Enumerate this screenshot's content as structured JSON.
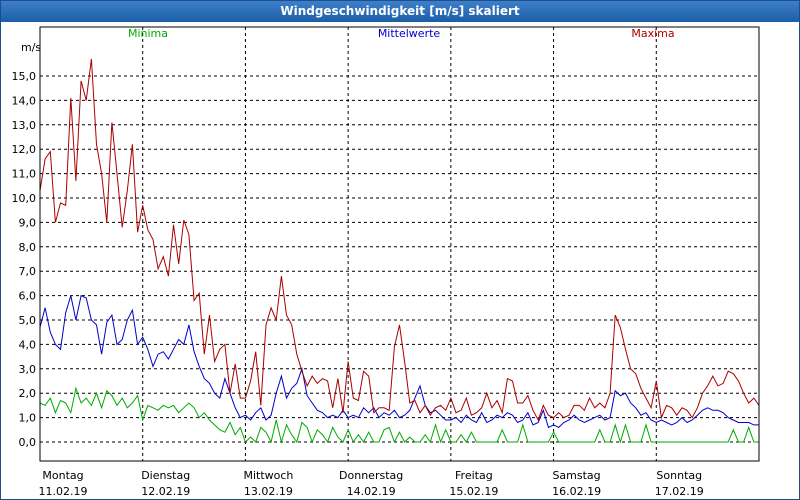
{
  "window": {
    "title": "Windgeschwindigkeit [m/s] skaliert"
  },
  "chart_data": {
    "type": "line",
    "title": "Windgeschwindigkeit [m/s] skaliert",
    "ylabel": "m/s",
    "ylim": [
      0,
      16
    ],
    "yticks": [
      0,
      1,
      2,
      3,
      4,
      5,
      6,
      7,
      8,
      9,
      10,
      11,
      12,
      13,
      14,
      15
    ],
    "ytick_labels": [
      "0,0",
      "1,0",
      "2,0",
      "3,0",
      "4,0",
      "5,0",
      "6,0",
      "7,0",
      "8,0",
      "9,0",
      "10,0",
      "11,0",
      "12,0",
      "13,0",
      "14,0",
      "15,0"
    ],
    "xlim": [
      0,
      7
    ],
    "grid": true,
    "legend": "top",
    "days": [
      {
        "weekday": "Montag",
        "date": "11.02.19"
      },
      {
        "weekday": "Dienstag",
        "date": "12.02.19"
      },
      {
        "weekday": "Mittwoch",
        "date": "13.02.19"
      },
      {
        "weekday": "Donnerstag",
        "date": "14.02.19"
      },
      {
        "weekday": "Freitag",
        "date": "15.02.19"
      },
      {
        "weekday": "Samstag",
        "date": "16.02.19"
      },
      {
        "weekday": "Sonntag",
        "date": "17.02.19"
      }
    ],
    "series": [
      {
        "name": "Minima",
        "color": "#00aa00",
        "x": [
          0,
          0.05,
          0.1,
          0.15,
          0.2,
          0.25,
          0.3,
          0.35,
          0.4,
          0.45,
          0.5,
          0.55,
          0.6,
          0.65,
          0.7,
          0.75,
          0.8,
          0.85,
          0.9,
          0.95,
          1,
          1.05,
          1.1,
          1.15,
          1.2,
          1.25,
          1.3,
          1.35,
          1.4,
          1.45,
          1.5,
          1.55,
          1.6,
          1.65,
          1.7,
          1.75,
          1.8,
          1.85,
          1.9,
          1.95,
          2,
          2.05,
          2.1,
          2.15,
          2.2,
          2.25,
          2.3,
          2.35,
          2.4,
          2.45,
          2.5,
          2.55,
          2.6,
          2.65,
          2.7,
          2.75,
          2.8,
          2.85,
          2.9,
          2.95,
          3,
          3.05,
          3.1,
          3.15,
          3.2,
          3.25,
          3.3,
          3.35,
          3.4,
          3.45,
          3.5,
          3.55,
          3.6,
          3.65,
          3.7,
          3.75,
          3.8,
          3.85,
          3.9,
          3.95,
          4,
          4.05,
          4.1,
          4.15,
          4.2,
          4.25,
          4.3,
          4.35,
          4.4,
          4.45,
          4.5,
          4.55,
          4.6,
          4.65,
          4.7,
          4.75,
          4.8,
          4.85,
          4.9,
          4.95,
          5,
          5.05,
          5.1,
          5.15,
          5.2,
          5.25,
          5.3,
          5.35,
          5.4,
          5.45,
          5.5,
          5.55,
          5.6,
          5.65,
          5.7,
          5.75,
          5.8,
          5.85,
          5.9,
          5.95,
          6,
          6.05,
          6.1,
          6.15,
          6.2,
          6.25,
          6.3,
          6.35,
          6.4,
          6.45,
          6.5,
          6.55,
          6.6,
          6.65,
          6.7,
          6.75,
          6.8,
          6.85,
          6.9,
          6.95,
          7
        ],
        "values": [
          1.6,
          1.5,
          1.8,
          1.2,
          1.7,
          1.6,
          1.2,
          2.2,
          1.6,
          1.8,
          1.5,
          2.0,
          1.4,
          2.1,
          1.9,
          1.5,
          1.8,
          1.4,
          1.6,
          1.9,
          0.9,
          1.5,
          1.4,
          1.3,
          1.5,
          1.4,
          1.5,
          1.2,
          1.4,
          1.6,
          1.4,
          1.0,
          1.2,
          0.9,
          0.7,
          0.5,
          0.4,
          0.8,
          0.3,
          0.6,
          0.0,
          0.2,
          0.0,
          0.6,
          0.4,
          0.0,
          0.9,
          0.0,
          0.7,
          0.3,
          0.0,
          0.8,
          0.6,
          0.0,
          0.5,
          0.3,
          0.0,
          0.6,
          0.2,
          0.0,
          0.5,
          0.0,
          0.3,
          0.0,
          0.4,
          0.0,
          0.0,
          0.5,
          0.6,
          0.0,
          0.4,
          0.0,
          0.2,
          0.0,
          0.0,
          0.3,
          0.0,
          0.7,
          0.0,
          0.5,
          0.0,
          0.0,
          0.3,
          0.0,
          0.4,
          0.0,
          0.0,
          0.0,
          0.0,
          0.0,
          0.5,
          0.0,
          0.0,
          0.0,
          0.7,
          0.0,
          0.0,
          0.0,
          0.0,
          0.0,
          0.4,
          0.0,
          0.0,
          0.0,
          0.0,
          0.0,
          0.0,
          0.0,
          0.0,
          0.5,
          0.0,
          0.0,
          0.7,
          0.0,
          0.7,
          0.0,
          0.0,
          0.0,
          0.7,
          0.0,
          0.0,
          0.0,
          0.0,
          0.0,
          0.0,
          0.0,
          0.0,
          0.0,
          0.0,
          0.0,
          0.0,
          0.0,
          0.0,
          0.0,
          0.0,
          0.5,
          0.0,
          0.0,
          0.6,
          0.0,
          0.0
        ]
      },
      {
        "name": "Mittelwerte",
        "color": "#0000cc",
        "x": [
          0,
          0.05,
          0.1,
          0.15,
          0.2,
          0.25,
          0.3,
          0.35,
          0.4,
          0.45,
          0.5,
          0.55,
          0.6,
          0.65,
          0.7,
          0.75,
          0.8,
          0.85,
          0.9,
          0.95,
          1,
          1.05,
          1.1,
          1.15,
          1.2,
          1.25,
          1.3,
          1.35,
          1.4,
          1.45,
          1.5,
          1.55,
          1.6,
          1.65,
          1.7,
          1.75,
          1.8,
          1.85,
          1.9,
          1.95,
          2,
          2.05,
          2.1,
          2.15,
          2.2,
          2.25,
          2.3,
          2.35,
          2.4,
          2.45,
          2.5,
          2.55,
          2.6,
          2.65,
          2.7,
          2.75,
          2.8,
          2.85,
          2.9,
          2.95,
          3,
          3.05,
          3.1,
          3.15,
          3.2,
          3.25,
          3.3,
          3.35,
          3.4,
          3.45,
          3.5,
          3.55,
          3.6,
          3.65,
          3.7,
          3.75,
          3.8,
          3.85,
          3.9,
          3.95,
          4,
          4.05,
          4.1,
          4.15,
          4.2,
          4.25,
          4.3,
          4.35,
          4.4,
          4.45,
          4.5,
          4.55,
          4.6,
          4.65,
          4.7,
          4.75,
          4.8,
          4.85,
          4.9,
          4.95,
          5,
          5.05,
          5.1,
          5.15,
          5.2,
          5.25,
          5.3,
          5.35,
          5.4,
          5.45,
          5.5,
          5.55,
          5.6,
          5.65,
          5.7,
          5.75,
          5.8,
          5.85,
          5.9,
          5.95,
          6,
          6.05,
          6.1,
          6.15,
          6.2,
          6.25,
          6.3,
          6.35,
          6.4,
          6.45,
          6.5,
          6.55,
          6.6,
          6.65,
          6.7,
          6.75,
          6.8,
          6.85,
          6.9,
          6.95,
          7
        ],
        "values": [
          4.7,
          5.5,
          4.5,
          4.0,
          3.8,
          5.3,
          6.0,
          5.0,
          6.0,
          5.9,
          5.0,
          4.8,
          3.6,
          4.9,
          5.2,
          4.0,
          4.2,
          5.0,
          5.4,
          4.0,
          4.3,
          3.8,
          3.1,
          3.6,
          3.7,
          3.4,
          3.8,
          4.2,
          4.0,
          4.8,
          3.7,
          3.1,
          2.6,
          2.4,
          2.0,
          1.8,
          2.6,
          2.0,
          1.4,
          1.0,
          1.1,
          0.9,
          1.2,
          1.4,
          0.9,
          1.1,
          2.0,
          2.7,
          1.8,
          2.2,
          2.4,
          3.0,
          1.9,
          1.6,
          1.3,
          1.2,
          1.0,
          1.1,
          1.0,
          1.3,
          1.0,
          1.1,
          1.0,
          1.4,
          1.2,
          1.4,
          1.0,
          1.2,
          1.1,
          1.3,
          1.0,
          1.1,
          1.3,
          1.8,
          2.3,
          1.5,
          1.2,
          1.3,
          1.1,
          0.9,
          0.9,
          1.0,
          0.8,
          1.1,
          0.9,
          0.8,
          1.2,
          0.8,
          0.9,
          1.1,
          1.0,
          1.2,
          1.1,
          0.8,
          0.9,
          1.2,
          0.7,
          0.8,
          1.3,
          0.6,
          0.7,
          0.6,
          0.8,
          0.9,
          1.1,
          0.9,
          0.8,
          0.9,
          1.0,
          1.1,
          0.9,
          1.0,
          2.1,
          1.9,
          2.0,
          1.6,
          1.4,
          1.1,
          1.2,
          0.9,
          0.8,
          0.9,
          0.8,
          0.7,
          0.8,
          1.0,
          0.8,
          0.9,
          1.1,
          1.3,
          1.4,
          1.3,
          1.3,
          1.2,
          1.0,
          0.9,
          0.8,
          0.8,
          0.8,
          0.7,
          0.7
        ]
      },
      {
        "name": "Maxima",
        "color": "#aa0000",
        "x": [
          0,
          0.05,
          0.1,
          0.15,
          0.2,
          0.25,
          0.3,
          0.35,
          0.4,
          0.45,
          0.5,
          0.55,
          0.6,
          0.65,
          0.7,
          0.75,
          0.8,
          0.85,
          0.9,
          0.95,
          1,
          1.05,
          1.1,
          1.15,
          1.2,
          1.25,
          1.3,
          1.35,
          1.4,
          1.45,
          1.5,
          1.55,
          1.6,
          1.65,
          1.7,
          1.75,
          1.8,
          1.85,
          1.9,
          1.95,
          2,
          2.05,
          2.1,
          2.15,
          2.2,
          2.25,
          2.3,
          2.35,
          2.4,
          2.45,
          2.5,
          2.55,
          2.6,
          2.65,
          2.7,
          2.75,
          2.8,
          2.85,
          2.9,
          2.95,
          3,
          3.05,
          3.1,
          3.15,
          3.2,
          3.25,
          3.3,
          3.35,
          3.4,
          3.45,
          3.5,
          3.55,
          3.6,
          3.65,
          3.7,
          3.75,
          3.8,
          3.85,
          3.9,
          3.95,
          4,
          4.05,
          4.1,
          4.15,
          4.2,
          4.25,
          4.3,
          4.35,
          4.4,
          4.45,
          4.5,
          4.55,
          4.6,
          4.65,
          4.7,
          4.75,
          4.8,
          4.85,
          4.9,
          4.95,
          5,
          5.05,
          5.1,
          5.15,
          5.2,
          5.25,
          5.3,
          5.35,
          5.4,
          5.45,
          5.5,
          5.55,
          5.6,
          5.65,
          5.7,
          5.75,
          5.8,
          5.85,
          5.9,
          5.95,
          6,
          6.05,
          6.1,
          6.15,
          6.2,
          6.25,
          6.3,
          6.35,
          6.4,
          6.45,
          6.5,
          6.55,
          6.6,
          6.65,
          6.7,
          6.75,
          6.8,
          6.85,
          6.9,
          6.95,
          7
        ],
        "values": [
          10.3,
          11.6,
          11.9,
          9.0,
          9.8,
          9.7,
          14.1,
          10.7,
          14.8,
          14.0,
          15.7,
          12.2,
          11.0,
          9.0,
          13.1,
          11.0,
          8.8,
          10.3,
          12.2,
          8.6,
          9.7,
          8.7,
          8.3,
          7.1,
          7.6,
          6.8,
          8.9,
          7.3,
          9.1,
          8.5,
          5.8,
          6.1,
          3.6,
          5.2,
          3.3,
          3.8,
          4.0,
          2.0,
          3.2,
          1.8,
          1.8,
          2.5,
          3.7,
          1.5,
          4.8,
          5.5,
          5.0,
          6.8,
          5.2,
          4.8,
          3.6,
          2.9,
          2.3,
          2.7,
          2.4,
          2.6,
          2.5,
          1.4,
          2.6,
          1.2,
          3.3,
          1.8,
          1.7,
          2.9,
          2.7,
          1.2,
          1.4,
          1.4,
          1.3,
          3.9,
          4.8,
          3.3,
          1.6,
          1.7,
          1.2,
          1.5,
          1.1,
          1.4,
          1.5,
          1.3,
          1.8,
          1.2,
          1.3,
          1.8,
          1.1,
          1.2,
          1.4,
          2.0,
          1.4,
          1.7,
          1.2,
          2.6,
          2.5,
          1.6,
          1.6,
          1.9,
          1.3,
          0.9,
          1.5,
          1.1,
          1.0,
          1.2,
          1.0,
          1.1,
          1.5,
          1.5,
          1.3,
          1.8,
          1.4,
          1.6,
          1.4,
          2.0,
          5.2,
          4.7,
          3.8,
          3.0,
          2.8,
          2.2,
          1.8,
          1.4,
          2.5,
          1.0,
          1.5,
          1.4,
          1.1,
          1.4,
          1.3,
          1.0,
          1.4,
          2.0,
          2.3,
          2.7,
          2.3,
          2.4,
          2.9,
          2.8,
          2.5,
          2.0,
          1.6,
          1.8,
          1.5
        ]
      }
    ]
  }
}
